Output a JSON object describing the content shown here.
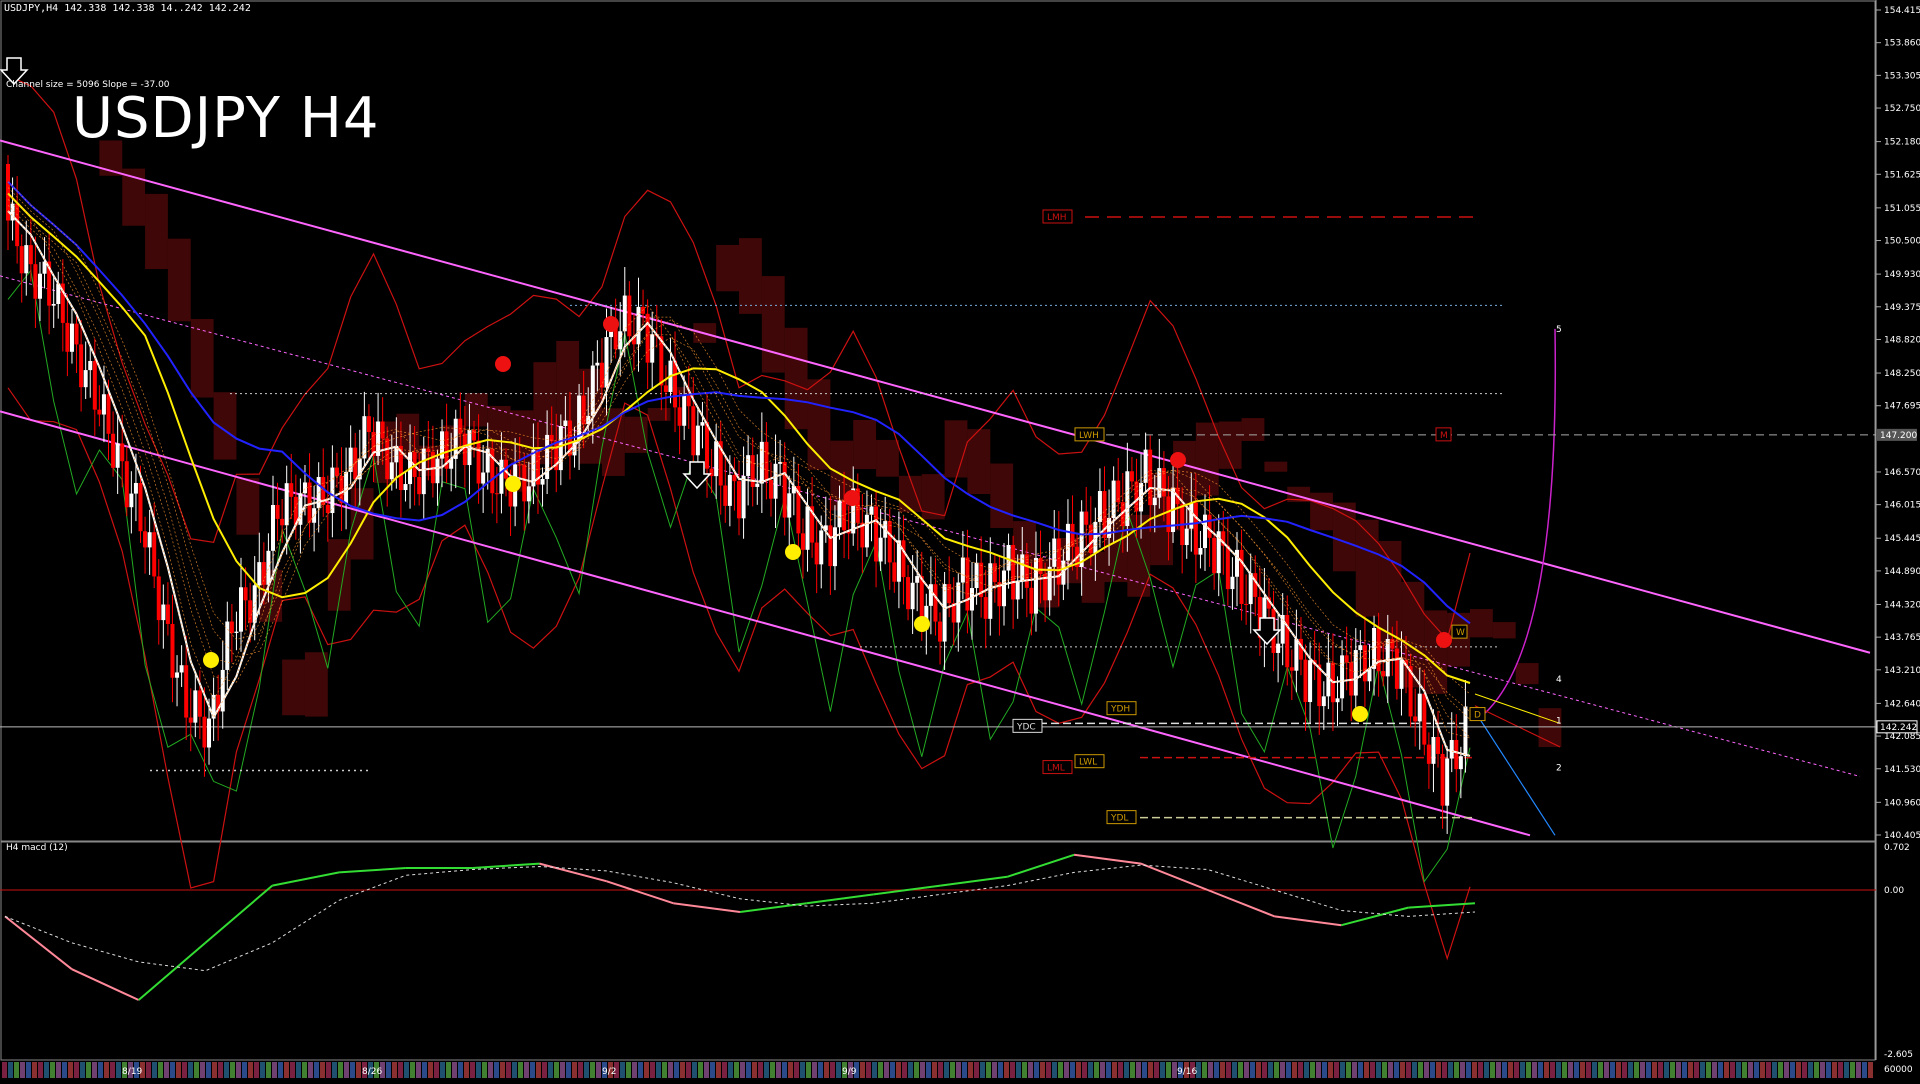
{
  "header": {
    "symbol_info": "USDJPY,H4  142.338 142.338 14..242 142.242"
  },
  "title": "USDJPY H4",
  "channel_info": "Channel size = 5096 Slope = -37.00",
  "macd_label": "H4  macd (12)",
  "colors": {
    "background": "#000000",
    "bull": "#ffffff",
    "bear": "#ff0000",
    "channel": "#ff66ff",
    "ma_white": "#ffffff",
    "ma_blue": "#2222ff",
    "ma_yellow": "#ffee00",
    "cloud": "#ff2020",
    "macd_up": "#33dd33",
    "macd_down": "#ff8899"
  },
  "chart_data": {
    "type": "line",
    "price_axis": {
      "ylim": [
        140.405,
        154.415
      ],
      "ticks": [
        "154.415",
        "153.860",
        "153.305",
        "152.750",
        "152.180",
        "151.625",
        "151.055",
        "150.500",
        "149.930",
        "149.375",
        "148.820",
        "148.250",
        "147.695",
        "146.570",
        "146.015",
        "145.445",
        "144.890",
        "144.320",
        "143.765",
        "143.210",
        "142.640",
        "142.085",
        "141.530",
        "140.960",
        "140.405"
      ],
      "current_price": "142.242",
      "marker_price": "147.200"
    },
    "macd_axis": {
      "ticks": [
        "0.702",
        "0.00",
        "-2.605"
      ],
      "bottom_label": "60000"
    },
    "time_axis": [
      "8/19",
      "8/26",
      "9/2",
      "9/9",
      "9/16"
    ],
    "close_series": [
      151.0,
      150.2,
      149.6,
      148.9,
      147.8,
      146.9,
      145.7,
      144.2,
      142.5,
      142.3,
      143.9,
      144.6,
      145.8,
      146.2,
      146.0,
      146.6,
      147.2,
      146.8,
      146.4,
      146.9,
      147.1,
      146.7,
      146.3,
      146.5,
      146.9,
      147.3,
      148.2,
      149.2,
      149.0,
      148.2,
      147.4,
      146.8,
      146.1,
      146.7,
      146.4,
      145.6,
      145.3,
      145.9,
      145.6,
      145.1,
      144.4,
      144.1,
      144.7,
      144.5,
      144.9,
      144.6,
      145.0,
      145.4,
      145.8,
      146.1,
      146.5,
      146.0,
      145.6,
      145.3,
      144.8,
      144.2,
      143.7,
      143.1,
      142.9,
      143.2,
      143.5,
      143.3,
      142.4,
      141.3,
      142.2
    ],
    "levels": [
      {
        "name": "LMH",
        "price": 150.9
      },
      {
        "name": "LWH",
        "price": 147.2
      },
      {
        "name": "M",
        "price": 147.2
      },
      {
        "name": "YDH",
        "price": 142.45
      },
      {
        "name": "YDC",
        "price": 142.25
      },
      {
        "name": "LWL",
        "price": 141.75
      },
      {
        "name": "LML",
        "price": 141.65
      },
      {
        "name": "YDL",
        "price": 140.7
      },
      {
        "name": "W",
        "price": 143.7
      },
      {
        "name": "D",
        "price": 142.35
      }
    ],
    "channel_labels": [
      "5",
      "4",
      "1",
      "2"
    ],
    "macd": {
      "values": [
        -0.6,
        -1.8,
        -2.5,
        -1.2,
        0.1,
        0.4,
        0.5,
        0.5,
        0.6,
        0.2,
        -0.3,
        -0.5,
        -0.3,
        -0.1,
        0.1,
        0.3,
        0.8,
        0.6,
        0.0,
        -0.6,
        -0.8,
        -0.4,
        -0.3
      ]
    }
  }
}
